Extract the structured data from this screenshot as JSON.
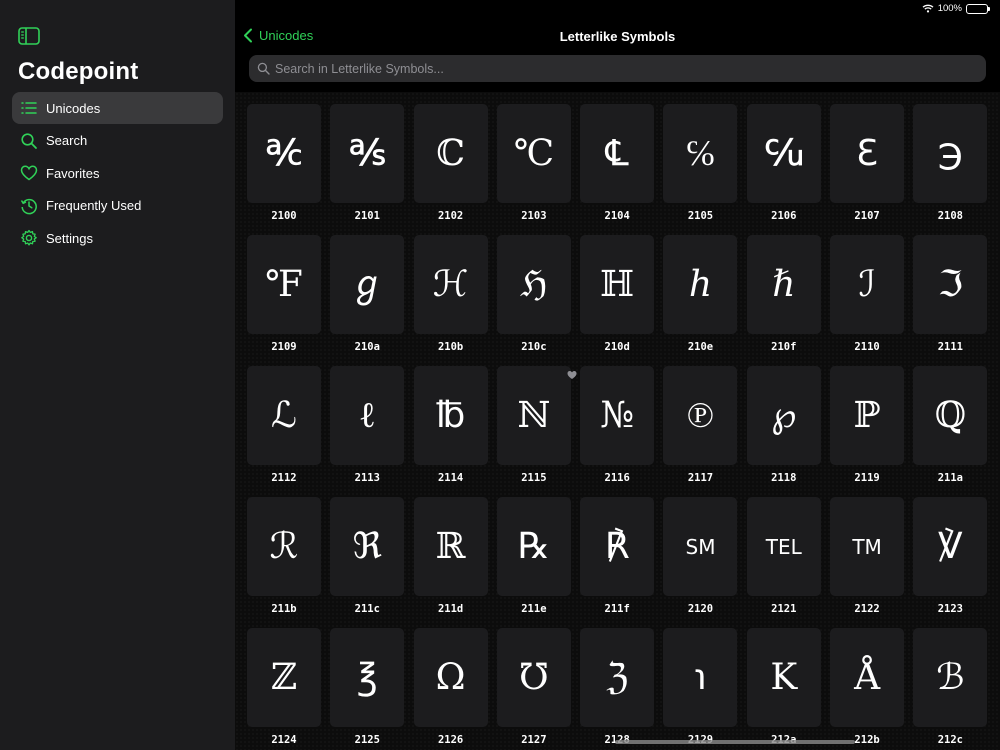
{
  "app": {
    "title": "Codepoint"
  },
  "sidebar": {
    "items": [
      {
        "label": "Unicodes",
        "icon": "list-icon",
        "active": true
      },
      {
        "label": "Search",
        "icon": "search-icon",
        "active": false
      },
      {
        "label": "Favorites",
        "icon": "heart-icon",
        "active": false
      },
      {
        "label": "Frequently Used",
        "icon": "history-icon",
        "active": false
      },
      {
        "label": "Settings",
        "icon": "gear-icon",
        "active": false
      }
    ]
  },
  "status": {
    "battery": "100%"
  },
  "nav": {
    "back_label": "Unicodes",
    "title": "Letterlike Symbols"
  },
  "search": {
    "placeholder": "Search in Letterlike Symbols...",
    "value": ""
  },
  "colors": {
    "accent": "#30d158",
    "tile": "#1c1c1e",
    "sidebar": "#1c1c1e"
  },
  "glyphs": [
    {
      "char": "℀",
      "code": "2100"
    },
    {
      "char": "℁",
      "code": "2101"
    },
    {
      "char": "ℂ",
      "code": "2102"
    },
    {
      "char": "℃",
      "code": "2103"
    },
    {
      "char": "℄",
      "code": "2104"
    },
    {
      "char": "℅",
      "code": "2105"
    },
    {
      "char": "℆",
      "code": "2106"
    },
    {
      "char": "ℇ",
      "code": "2107"
    },
    {
      "char": "℈",
      "code": "2108"
    },
    {
      "char": "℉",
      "code": "2109"
    },
    {
      "char": "ℊ",
      "code": "210a"
    },
    {
      "char": "ℋ",
      "code": "210b"
    },
    {
      "char": "ℌ",
      "code": "210c"
    },
    {
      "char": "ℍ",
      "code": "210d"
    },
    {
      "char": "ℎ",
      "code": "210e"
    },
    {
      "char": "ℏ",
      "code": "210f"
    },
    {
      "char": "ℐ",
      "code": "2110"
    },
    {
      "char": "ℑ",
      "code": "2111"
    },
    {
      "char": "ℒ",
      "code": "2112"
    },
    {
      "char": "ℓ",
      "code": "2113"
    },
    {
      "char": "℔",
      "code": "2114"
    },
    {
      "char": "ℕ",
      "code": "2115",
      "favorite": true
    },
    {
      "char": "№",
      "code": "2116"
    },
    {
      "char": "℗",
      "code": "2117"
    },
    {
      "char": "℘",
      "code": "2118"
    },
    {
      "char": "ℙ",
      "code": "2119"
    },
    {
      "char": "ℚ",
      "code": "211a"
    },
    {
      "char": "ℛ",
      "code": "211b"
    },
    {
      "char": "ℜ",
      "code": "211c"
    },
    {
      "char": "ℝ",
      "code": "211d"
    },
    {
      "char": "℞",
      "code": "211e"
    },
    {
      "char": "℟",
      "code": "211f"
    },
    {
      "char": "SM",
      "code": "2120",
      "small": true
    },
    {
      "char": "TEL",
      "code": "2121",
      "small": true
    },
    {
      "char": "TM",
      "code": "2122",
      "small": true
    },
    {
      "char": "℣",
      "code": "2123"
    },
    {
      "char": "ℤ",
      "code": "2124"
    },
    {
      "char": "℥",
      "code": "2125"
    },
    {
      "char": "Ω",
      "code": "2126"
    },
    {
      "char": "℧",
      "code": "2127"
    },
    {
      "char": "ℨ",
      "code": "2128"
    },
    {
      "char": "℩",
      "code": "2129"
    },
    {
      "char": "K",
      "code": "212a"
    },
    {
      "char": "Å",
      "code": "212b"
    },
    {
      "char": "ℬ",
      "code": "212c"
    }
  ]
}
